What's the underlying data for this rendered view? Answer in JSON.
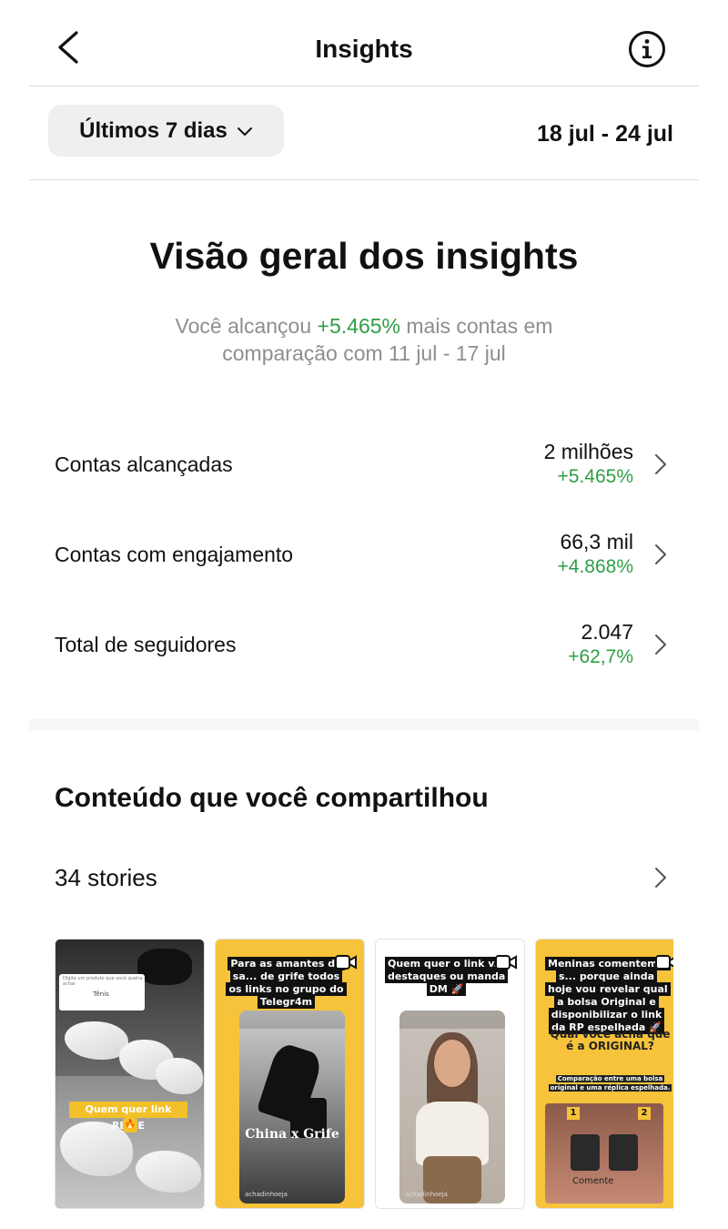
{
  "header": {
    "title": "Insights"
  },
  "filter": {
    "period_label": "Últimos 7 dias",
    "date_range": "18 jul - 24 jul"
  },
  "overview": {
    "title": "Visão geral dos insights",
    "subtitle_prefix": "Você alcançou ",
    "subtitle_highlight": "+5.465%",
    "subtitle_mid": " mais contas em",
    "subtitle_line2": "comparação com 11 jul - 17 jul"
  },
  "metrics": [
    {
      "label": "Contas alcançadas",
      "value": "2 milhões",
      "change": "+5.465%"
    },
    {
      "label": "Contas com engajamento",
      "value": "66,3 mil",
      "change": "+4.868%"
    },
    {
      "label": "Total de seguidores",
      "value": "2.047",
      "change": "+62,7%"
    }
  ],
  "content": {
    "title": "Conteúdo que você compartilhou",
    "stories_label": "34 stories"
  },
  "thumbnails": [
    {
      "search_hint": "Digite um produto que você queira achar",
      "search_text": "Tênis",
      "caption": "Quem quer link REAJE",
      "emoji": "🔥"
    },
    {
      "caption": "Para as amantes de sa... de grife todos os links no grupo do Telegr4m",
      "overlay": "China x Grife",
      "handle": "achadinhoeja"
    },
    {
      "caption": "Quem quer o link v... destaques ou manda DM 🚀",
      "handle": "achadinhoeja"
    },
    {
      "caption": "Meninas comentem e s... porque ainda hoje vou revelar qual a bolsa Original e disponibilizar o link da RP espelhada 🚀",
      "quiz_title": "Qual você acha que é a ORIGINAL?",
      "quiz_sub": "Comparação entre uma bolsa original e uma réplica espelhada.",
      "badge_1": "1",
      "badge_2": "2",
      "comment_label": "Comente"
    }
  ],
  "colors": {
    "positive": "#2f9e44",
    "muted_text": "#8e8e8e",
    "story_yellow": "#f6c33a"
  },
  "icons": [
    "back-chevron-icon",
    "info-icon",
    "chevron-down-icon",
    "chevron-right-icon",
    "video-icon"
  ]
}
